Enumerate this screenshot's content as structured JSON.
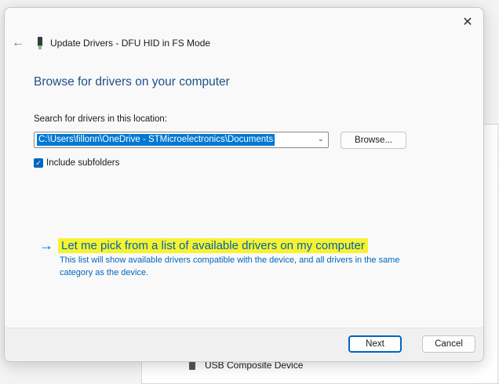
{
  "window": {
    "title": "Update Drivers - DFU HID in FS Mode",
    "close_glyph": "✕",
    "back_glyph": "←"
  },
  "main": {
    "heading": "Browse for drivers on your computer",
    "search_label": "Search for drivers in this location:",
    "path_value": "C:\\Users\\fillonn\\OneDrive - STMicroelectronics\\Documents",
    "browse_label": "Browse...",
    "include_subfolders_label": "Include subfolders",
    "include_subfolders_checked": true,
    "pick_link_arrow": "→",
    "pick_link_text": "Let me pick from a list of available drivers on my computer",
    "pick_link_description": "This list will show available drivers compatible with the device, and all drivers in the same category as the device."
  },
  "footer": {
    "next_label": "Next",
    "cancel_label": "Cancel"
  },
  "background_window": {
    "visible_item": "USB Composite Device"
  },
  "colors": {
    "accent": "#0067c0",
    "heading": "#1f4e8c",
    "highlight": "#f6f32e"
  },
  "icons": {
    "device": "usb-device-icon",
    "back": "back-arrow-icon",
    "close": "close-icon",
    "check": "checkmark-icon",
    "dropdown": "chevron-down-icon",
    "link_arrow": "arrow-right-icon"
  }
}
